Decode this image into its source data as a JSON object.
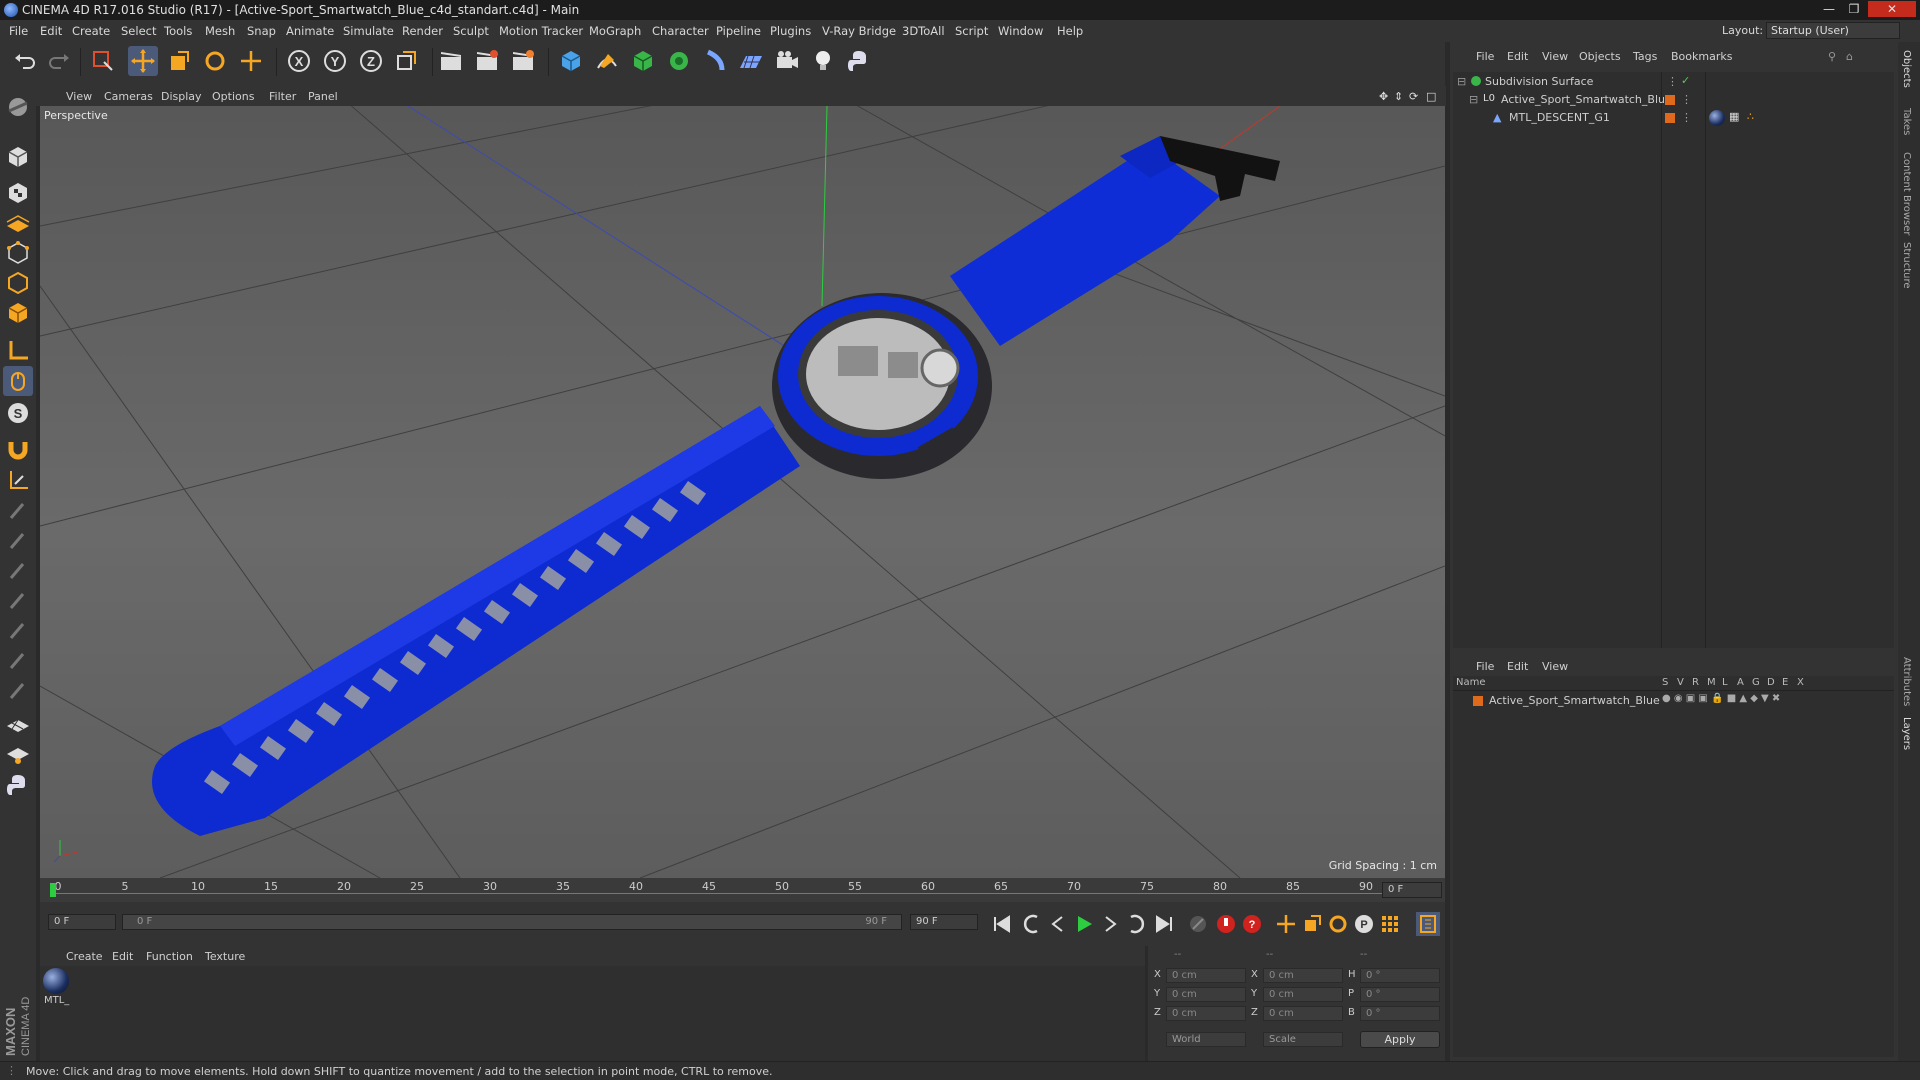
{
  "window": {
    "title": "CINEMA 4D R17.016 Studio (R17) - [Active-Sport_Smartwatch_Blue_c4d_standart.c4d] - Main",
    "layout_label": "Layout:",
    "layout_value": "Startup (User)"
  },
  "menu": [
    "File",
    "Edit",
    "Create",
    "Select",
    "Tools",
    "Mesh",
    "Snap",
    "Animate",
    "Simulate",
    "Render",
    "Sculpt",
    "Motion Tracker",
    "MoGraph",
    "Character",
    "Pipeline",
    "Plugins",
    "V-Ray Bridge",
    "3DToAll",
    "Script",
    "Window",
    "Help"
  ],
  "viewport": {
    "menu": [
      "View",
      "Cameras",
      "Display",
      "Options",
      "Filter",
      "Panel"
    ],
    "label": "Perspective",
    "grid_spacing": "Grid Spacing : 1 cm"
  },
  "timeline": {
    "ticks": [
      "0",
      "5",
      "10",
      "15",
      "20",
      "25",
      "30",
      "35",
      "40",
      "45",
      "50",
      "55",
      "60",
      "65",
      "70",
      "75",
      "80",
      "85",
      "90"
    ],
    "current_frame": "0 F",
    "start_field": "0 F",
    "range_start": "0 F",
    "range_end": "90 F",
    "end_field": "90 F"
  },
  "materials": {
    "menu": [
      "Create",
      "Edit",
      "Function",
      "Texture"
    ],
    "items": [
      {
        "label": "MTL_"
      }
    ]
  },
  "coordinates": {
    "headers": [
      "--",
      "--",
      "--"
    ],
    "rows": [
      {
        "a": "X",
        "av": "0 cm",
        "b": "X",
        "bv": "0 cm",
        "c": "H",
        "cv": "0 °"
      },
      {
        "a": "Y",
        "av": "0 cm",
        "b": "Y",
        "bv": "0 cm",
        "c": "P",
        "cv": "0 °"
      },
      {
        "a": "Z",
        "av": "0 cm",
        "b": "Z",
        "bv": "0 cm",
        "c": "B",
        "cv": "0 °"
      }
    ],
    "mode_world": "World",
    "mode_scale": "Scale",
    "apply": "Apply"
  },
  "objects_panel": {
    "menu": [
      "File",
      "Edit",
      "View",
      "Objects",
      "Tags",
      "Bookmarks"
    ],
    "items": [
      {
        "name": "Subdivision Surface",
        "indent": 0
      },
      {
        "name": "Active_Sport_Smartwatch_Blue",
        "indent": 1
      },
      {
        "name": "MTL_DESCENT_G1",
        "indent": 2
      }
    ]
  },
  "layers_panel": {
    "menu": [
      "File",
      "Edit",
      "View"
    ],
    "columns": [
      "Name",
      "S",
      "V",
      "R",
      "M",
      "L",
      "A",
      "G",
      "D",
      "E",
      "X"
    ],
    "items": [
      {
        "name": "Active_Sport_Smartwatch_Blue"
      }
    ]
  },
  "side_tabs": [
    "Objects",
    "Takes",
    "Content Browser",
    "Structure",
    "Attributes",
    "Layers"
  ],
  "status": "Move: Click and drag to move elements. Hold down SHIFT to quantize movement / add to the selection in point mode, CTRL to remove.",
  "brand": [
    "MAXON",
    "CINEMA 4D"
  ]
}
